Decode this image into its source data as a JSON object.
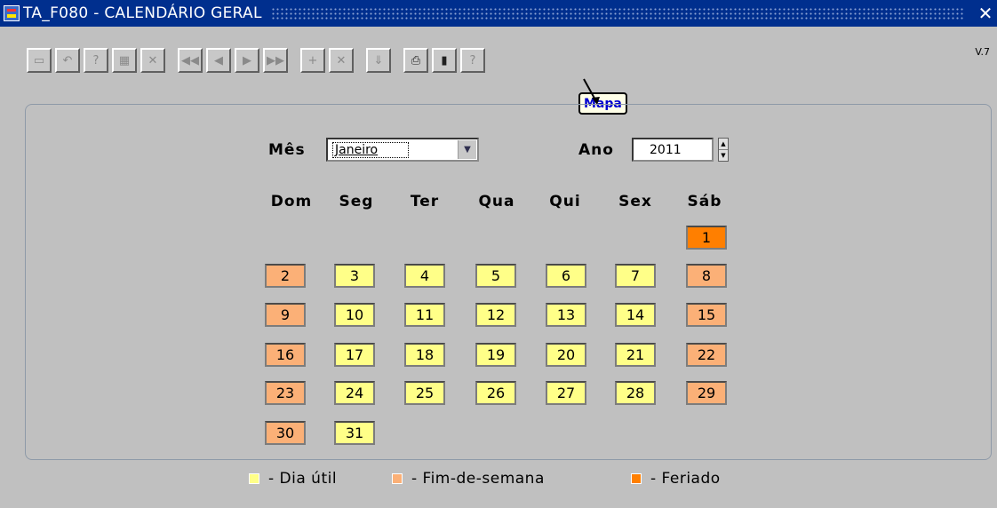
{
  "window": {
    "title": "TA_F080 - CALENDÁRIO GERAL",
    "close": "✕"
  },
  "toolbar": {
    "buttons": [
      {
        "name": "save",
        "glyph": "▭"
      },
      {
        "name": "undo",
        "glyph": "↶"
      },
      {
        "name": "query",
        "glyph": "?"
      },
      {
        "name": "execute-query",
        "glyph": "▦"
      },
      {
        "name": "cancel-query",
        "glyph": "✕"
      },
      {
        "name": "first-record",
        "glyph": "◀◀"
      },
      {
        "name": "previous-record",
        "glyph": "◀"
      },
      {
        "name": "next-record",
        "glyph": "▶"
      },
      {
        "name": "last-record",
        "glyph": "▶▶"
      },
      {
        "name": "insert-record",
        "glyph": "+"
      },
      {
        "name": "delete-record",
        "glyph": "✕"
      },
      {
        "name": "list-values",
        "glyph": "⇓"
      },
      {
        "name": "print",
        "glyph": "⎙"
      },
      {
        "name": "exit",
        "glyph": "▮"
      },
      {
        "name": "help",
        "glyph": "?"
      }
    ],
    "version": "V.7"
  },
  "tooltip": {
    "text": "Mapa"
  },
  "form": {
    "month_label": "Mês",
    "month_value": "Janeiro",
    "year_label": "Ano",
    "year_value": "2011"
  },
  "calendar": {
    "weekdays": [
      "Dom",
      "Seg",
      "Ter",
      "Qua",
      "Qui",
      "Sex",
      "Sáb"
    ],
    "days": [
      {
        "n": "1",
        "type": "feriado"
      },
      {
        "n": "2",
        "type": "fim"
      },
      {
        "n": "3",
        "type": "util"
      },
      {
        "n": "4",
        "type": "util"
      },
      {
        "n": "5",
        "type": "util"
      },
      {
        "n": "6",
        "type": "util"
      },
      {
        "n": "7",
        "type": "util"
      },
      {
        "n": "8",
        "type": "fim"
      },
      {
        "n": "9",
        "type": "fim"
      },
      {
        "n": "10",
        "type": "util"
      },
      {
        "n": "11",
        "type": "util"
      },
      {
        "n": "12",
        "type": "util"
      },
      {
        "n": "13",
        "type": "util"
      },
      {
        "n": "14",
        "type": "util"
      },
      {
        "n": "15",
        "type": "fim"
      },
      {
        "n": "16",
        "type": "fim"
      },
      {
        "n": "17",
        "type": "util"
      },
      {
        "n": "18",
        "type": "util"
      },
      {
        "n": "19",
        "type": "util"
      },
      {
        "n": "20",
        "type": "util"
      },
      {
        "n": "21",
        "type": "util"
      },
      {
        "n": "22",
        "type": "fim"
      },
      {
        "n": "23",
        "type": "fim"
      },
      {
        "n": "24",
        "type": "util"
      },
      {
        "n": "25",
        "type": "util"
      },
      {
        "n": "26",
        "type": "util"
      },
      {
        "n": "27",
        "type": "util"
      },
      {
        "n": "28",
        "type": "util"
      },
      {
        "n": "29",
        "type": "fim"
      },
      {
        "n": "30",
        "type": "fim"
      },
      {
        "n": "31",
        "type": "util"
      }
    ]
  },
  "legend": {
    "util": "- Dia útil",
    "fim": "- Fim-de-semana",
    "feriado": "- Feriado"
  },
  "colors": {
    "util": "#ffff88",
    "fim": "#fbb077",
    "feriado": "#ff7f00",
    "titlebar": "#002f8e"
  }
}
